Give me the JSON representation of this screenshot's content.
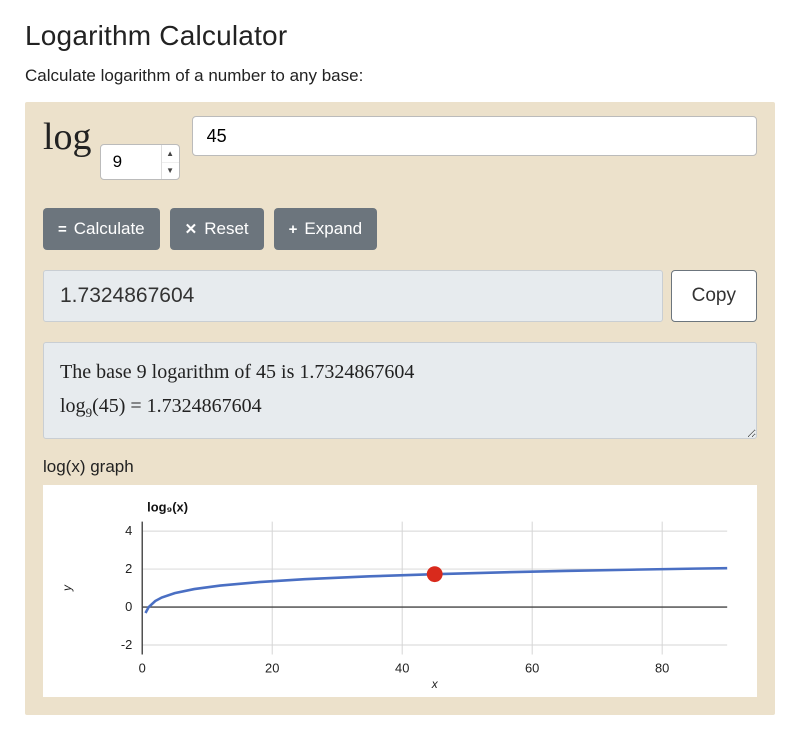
{
  "title": "Logarithm Calculator",
  "subtitle": "Calculate logarithm of a number to any base:",
  "log_label": "log",
  "base_value": "9",
  "arg_value": "45",
  "buttons": {
    "calculate": "Calculate",
    "reset": "Reset",
    "expand": "Expand",
    "copy": "Copy"
  },
  "result_value": "1.7324867604",
  "explanation": {
    "line1": "The base 9 logarithm of 45 is 1.7324867604",
    "line2_prefix": "log",
    "line2_sub": "9",
    "line2_rest": "(45) = 1.7324867604"
  },
  "graph_section_title": "log(x) graph",
  "chart_data": {
    "type": "line",
    "title": "log₉(x)",
    "xlabel": "x",
    "ylabel": "y",
    "xlim": [
      0,
      90
    ],
    "ylim": [
      -2.5,
      4.5
    ],
    "xticks": [
      0,
      20,
      40,
      60,
      80
    ],
    "yticks": [
      -2,
      0,
      2,
      4
    ],
    "series": [
      {
        "name": "log9(x)",
        "x": [
          0.5,
          1,
          2,
          3,
          5,
          8,
          12,
          18,
          25,
          35,
          45,
          55,
          65,
          75,
          85,
          90
        ],
        "y": [
          -0.315,
          0,
          0.315,
          0.5,
          0.732,
          0.946,
          1.131,
          1.315,
          1.465,
          1.618,
          1.732,
          1.824,
          1.9,
          1.965,
          2.022,
          2.048
        ]
      }
    ],
    "marker": {
      "x": 45,
      "y": 1.7324867604
    }
  }
}
